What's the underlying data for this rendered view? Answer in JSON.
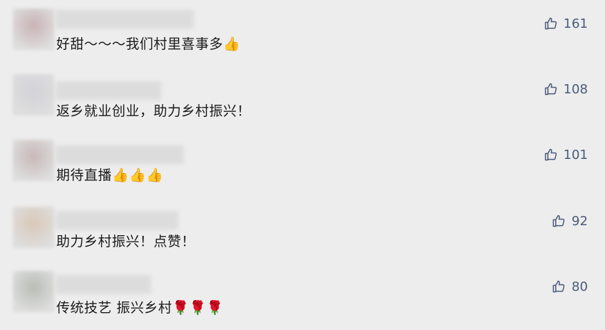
{
  "colors": {
    "background": "#ededed",
    "text": "#1a1a1a",
    "like_accent": "#4a5a7a"
  },
  "comments": [
    {
      "text": "好甜～～～我们村里喜事多",
      "emoji": "👍",
      "likes": "161",
      "avatar_color": "#c9b3b5"
    },
    {
      "text": "返乡就业创业，助力乡村振兴！",
      "emoji": "",
      "likes": "108",
      "avatar_color": "#d2d2d8"
    },
    {
      "text": "期待直播",
      "emoji": "👍👍👍",
      "likes": "101",
      "avatar_color": "#c8b8b8"
    },
    {
      "text": "助力乡村振兴！点赞！",
      "emoji": "",
      "likes": "92",
      "avatar_color": "#d9c8b8"
    },
    {
      "text": "传统技艺 振兴乡村",
      "emoji": "🌹🌹🌹",
      "likes": "80",
      "avatar_color": "#b9bdb4"
    }
  ],
  "icons": {
    "like": "thumbs-up-icon",
    "thumb_emoji": "thumbs-up-emoji",
    "rose_emoji": "rose-emoji"
  }
}
